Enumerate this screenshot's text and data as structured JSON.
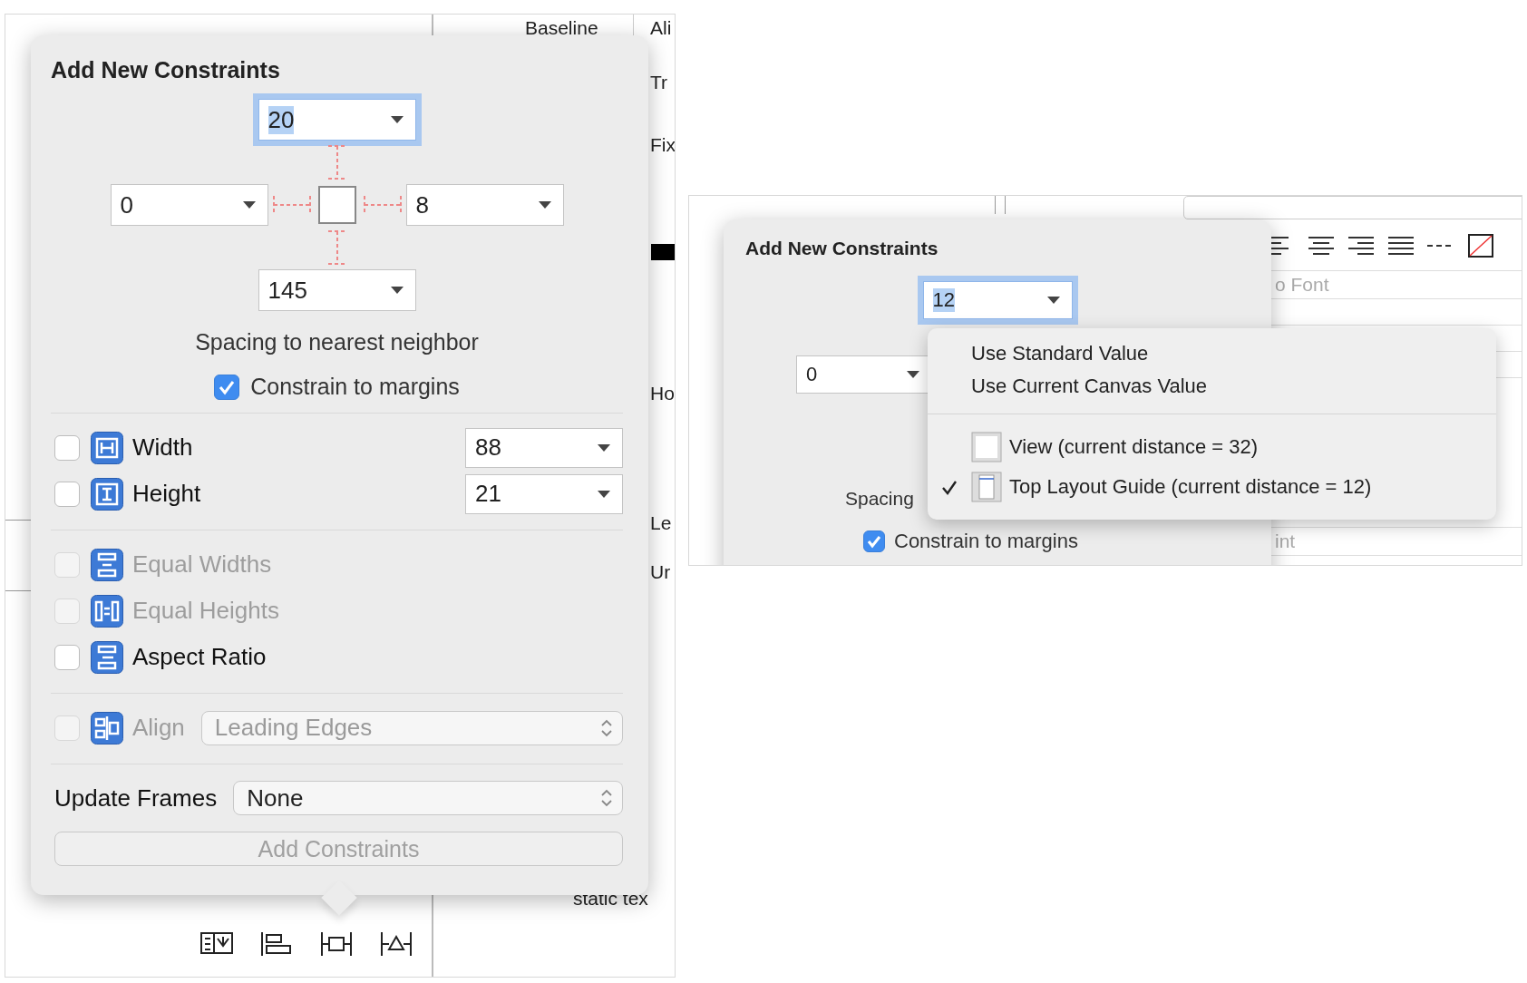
{
  "left_screenshot": {
    "background_labels": [
      "Baseline",
      "Ali",
      "Tr",
      "Fix",
      "Ho",
      "Le",
      "Ur",
      "static tex"
    ],
    "popover": {
      "title": "Add New Constraints",
      "spacing": {
        "top": {
          "value": "20",
          "focused": true
        },
        "left": {
          "value": "0",
          "focused": false
        },
        "right": {
          "value": "8",
          "focused": false
        },
        "bottom": {
          "value": "145",
          "focused": false
        }
      },
      "caption": "Spacing to nearest neighbor",
      "constrain_to_margins": {
        "label": "Constrain to margins",
        "checked": true
      },
      "size_rows": [
        {
          "label": "Width",
          "checked": false,
          "value": "88"
        },
        {
          "label": "Height",
          "checked": false,
          "value": "21"
        }
      ],
      "relation_rows": [
        {
          "label": "Equal Widths",
          "checked": false,
          "disabled": true
        },
        {
          "label": "Equal Heights",
          "checked": false,
          "disabled": true
        },
        {
          "label": "Aspect Ratio",
          "checked": false,
          "disabled": false
        }
      ],
      "align": {
        "label": "Align",
        "checked": false,
        "disabled": true,
        "value": "Leading Edges"
      },
      "update_frames": {
        "label": "Update Frames",
        "value": "None"
      },
      "add_button": {
        "label": "Add Constraints",
        "disabled": true
      }
    }
  },
  "right_screenshot": {
    "background_labels": [
      "o Font",
      "int"
    ],
    "popover": {
      "title": "Add New Constraints",
      "top": {
        "value": "12",
        "focused": true
      },
      "left": {
        "value": "0",
        "focused": false
      },
      "caption": "Spacing",
      "constrain_to_margins": {
        "label": "Constrain to margins",
        "checked": true
      }
    },
    "menu": {
      "actions": [
        {
          "label": "Use Standard Value"
        },
        {
          "label": "Use Current Canvas Value"
        }
      ],
      "anchors": [
        {
          "label": "View (current distance = 32)",
          "checked": false,
          "kind": "view"
        },
        {
          "label": "Top Layout Guide (current distance = 12)",
          "checked": true,
          "kind": "layout-guide"
        }
      ]
    }
  }
}
